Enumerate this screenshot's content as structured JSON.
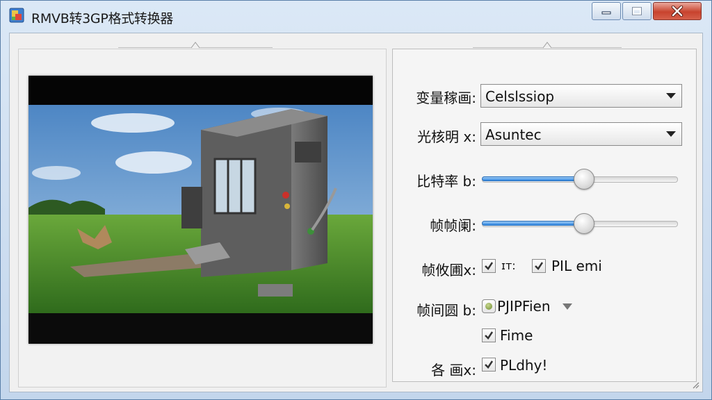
{
  "window": {
    "title": "RMVB转3GP格式转换器"
  },
  "settings": {
    "row1": {
      "label": "变量稼画:",
      "value": "Celslssiop"
    },
    "row2": {
      "label": "光核明 x:",
      "value": "Asuntec"
    },
    "row3": {
      "label": "比特率 b:",
      "level": 0.52
    },
    "row4": {
      "label": "帧帧阑:",
      "level": 0.52
    },
    "row5": {
      "label": "帧攸圃x:",
      "option1": {
        "text": "ɪᴛ:",
        "checked": true
      },
      "option2": {
        "text": "PIL emi",
        "checked": true
      }
    },
    "row6": {
      "label": "帧间圆 b:",
      "radio": {
        "text": "PJIPFien",
        "selected": true
      },
      "check": {
        "text": "Fime",
        "checked": true
      }
    },
    "row7": {
      "label": "各   画x:",
      "check": {
        "text": "PLdhy!",
        "checked": true
      }
    }
  },
  "colors": {
    "accent": "#2f86e0",
    "close_button": "#c8432e",
    "titlebar": "#c3d6ec"
  }
}
